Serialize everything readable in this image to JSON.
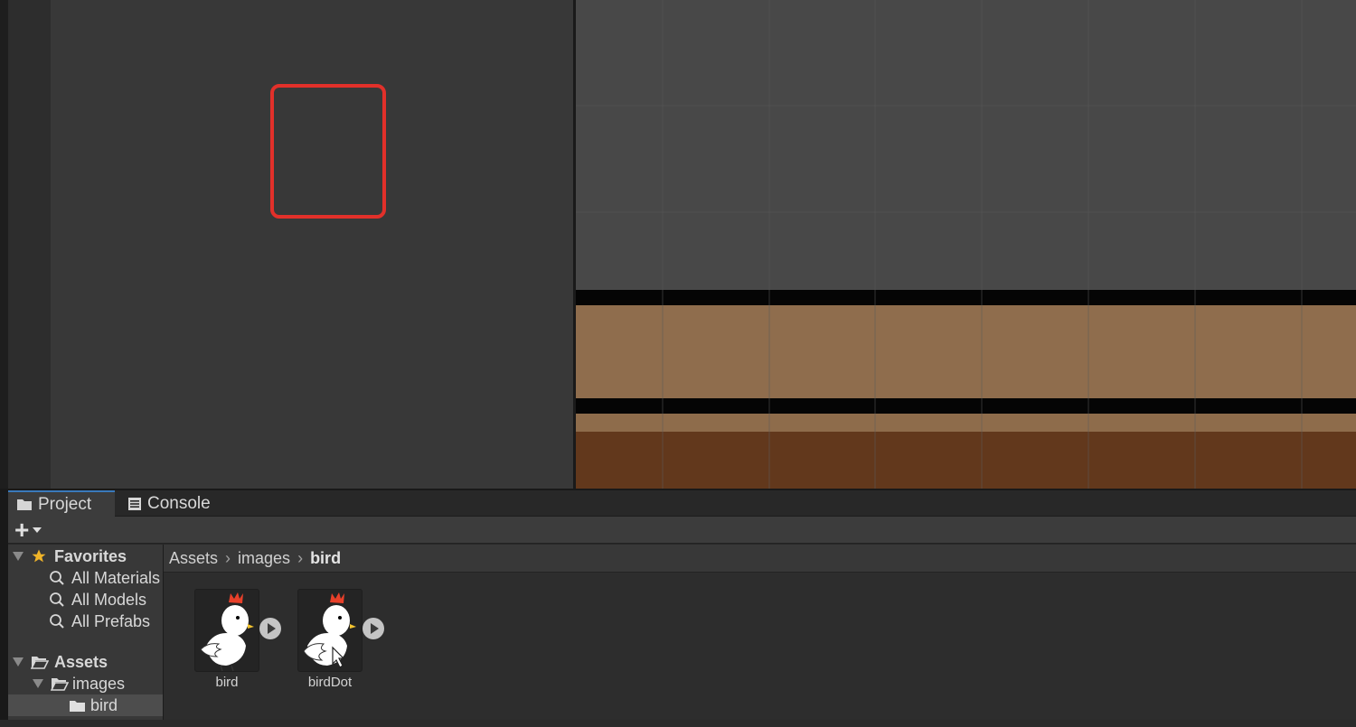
{
  "window": {
    "tabs": [
      {
        "label": "Project",
        "active": true
      },
      {
        "label": "Console",
        "active": false
      }
    ],
    "toolbar": {
      "add_label": "+"
    }
  },
  "tree": {
    "favorites": {
      "label": "Favorites",
      "items": [
        "All Materials",
        "All Models",
        "All Prefabs"
      ]
    },
    "assets": {
      "label": "Assets",
      "children": [
        {
          "label": "images",
          "children": [
            {
              "label": "bird",
              "selected": true
            }
          ]
        }
      ]
    }
  },
  "breadcrumb": [
    "Assets",
    "images",
    "bird"
  ],
  "assets": [
    {
      "name": "bird",
      "has_play": true
    },
    {
      "name": "birdDot",
      "has_play": true,
      "highlighted": true
    }
  ],
  "colors": {
    "accent": "#3a79bb",
    "highlight": "#e2302a",
    "ground_top": "#8f6d4d",
    "ground_dark": "#62381c"
  },
  "icons": {
    "project_tab": "folder-icon",
    "console_tab": "console-icon",
    "favorites": "star-icon",
    "search_item": "magnifier-icon",
    "folder_open": "open-folder-icon",
    "folder": "folder-icon",
    "play": "play-icon"
  }
}
